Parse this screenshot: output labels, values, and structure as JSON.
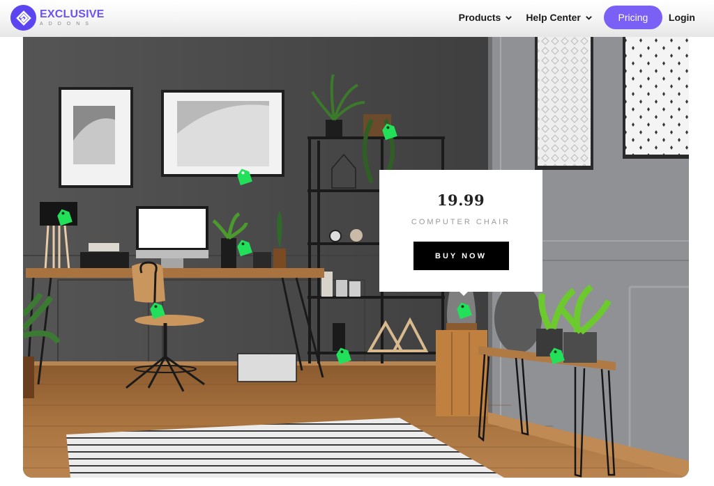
{
  "header": {
    "logo": {
      "name": "EXCLUSIVE",
      "sub": "ADDONS",
      "brand_color": "#5b45f0"
    },
    "nav": [
      {
        "label": "Products",
        "has_dropdown": true,
        "icon": "chevron-down-icon"
      },
      {
        "label": "Help Center",
        "has_dropdown": true,
        "icon": "chevron-down-icon"
      }
    ],
    "pricing_label": "Pricing",
    "pricing_color": "#7b60f5",
    "login_label": "Login"
  },
  "hotspots": {
    "tag_color": "#22e05a",
    "tags": [
      {
        "name": "frame-tag",
        "icon": "price-tag-icon"
      },
      {
        "name": "hanging-plant-tag",
        "icon": "price-tag-icon"
      },
      {
        "name": "lamp-tag",
        "icon": "price-tag-icon"
      },
      {
        "name": "desk-plant-tag",
        "icon": "price-tag-icon"
      },
      {
        "name": "chair-tag",
        "icon": "price-tag-icon"
      },
      {
        "name": "glass-vase-tag",
        "icon": "price-tag-icon",
        "active": true
      },
      {
        "name": "shelf-vase-tag",
        "icon": "price-tag-icon"
      },
      {
        "name": "bench-plant-tag",
        "icon": "price-tag-icon"
      }
    ]
  },
  "popup": {
    "price": "19.99",
    "product_name": "COMPUTER CHAIR",
    "button_label": "BUY NOW"
  }
}
